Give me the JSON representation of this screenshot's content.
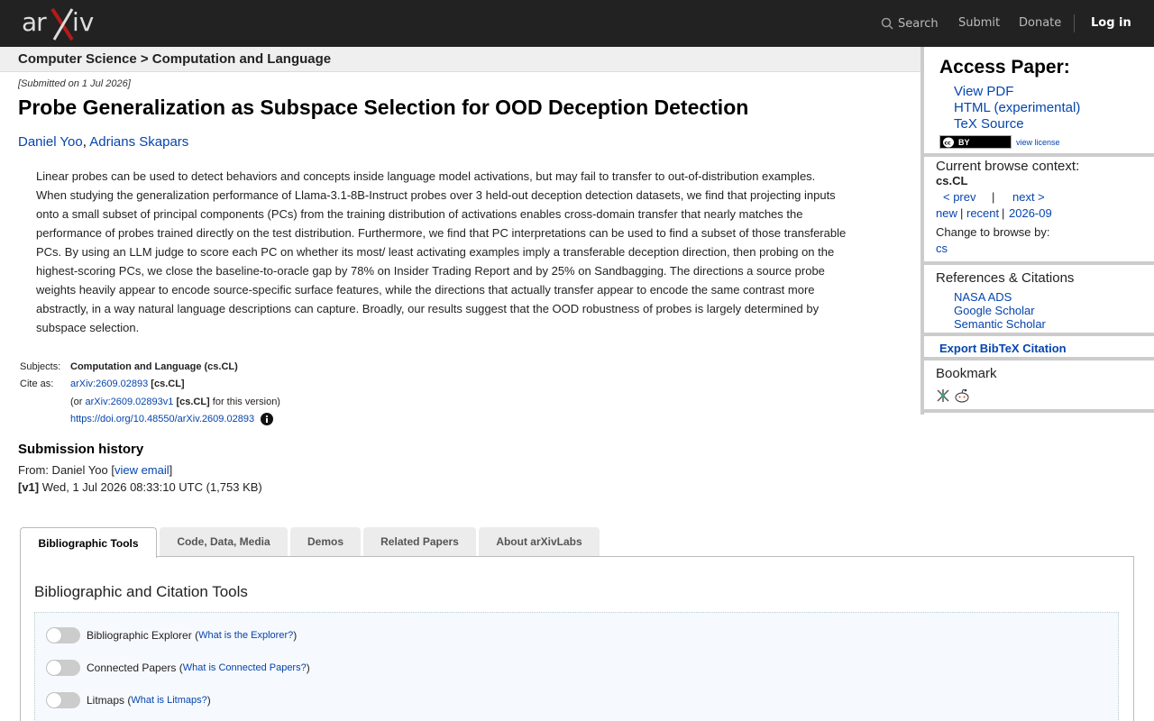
{
  "header": {
    "logo_text": "arXiv",
    "search_label": "Search",
    "submit_label": "Submit",
    "donate_label": "Donate",
    "login_label": "Log in"
  },
  "breadcrumb": "Computer Science > Computation and Language",
  "paper": {
    "submitted": "[Submitted on 1 Jul 2026]",
    "title": "Probe Generalization as Subspace Selection for OOD Deception Detection",
    "authors": [
      "Daniel Yoo",
      "Adrians Skapars"
    ],
    "abstract_lines": [
      "Linear probes can be used to detect behaviors and concepts inside language model activations, but may fail to transfer to out-of-distribution examples.",
      "When studying the generalization performance of Llama-3.1-8B-Instruct probes over 3 held-out deception detection datasets, we find that projecting inputs",
      "onto a small subset of principal components (PCs) from the training distribution of activations enables cross-domain transfer that nearly matches the",
      "performance of probes trained directly on the test distribution. Furthermore, we find that PC interpretations can be used to find a subset of those transferable",
      "PCs. By using an LLM judge to score each PC on whether its most/ least activating examples imply a transferable deception direction, then probing on the",
      "highest-scoring PCs, we close the baseline-to-oracle gap by 78% on Insider Trading Report and by 25% on Sandbagging. The directions a source probe",
      "weights heavily appear to encode source-specific surface features, while the directions that actually transfer appear to encode the same contrast more",
      "abstractly, in a way natural language descriptions can capture. Broadly, our results suggest that the OOD robustness of probes is largely determined by",
      "subspace selection."
    ]
  },
  "meta": {
    "subjects_label": "Subjects:",
    "subjects_value": "Computation and Language (cs.CL)",
    "cite_label": "Cite as:",
    "cite_id": "arXiv:2609.02893",
    "cite_tag": "[cs.CL]",
    "cite_or": "(or",
    "cite_version_id": "arXiv:2609.02893v1",
    "cite_version_tag": "[cs.CL]",
    "cite_version_suffix": "for this version)",
    "doi": "https://doi.org/10.48550/arXiv.2609.02893"
  },
  "history": {
    "title": "Submission history",
    "from_prefix": "From: Daniel Yoo [",
    "view_email": "view email",
    "from_suffix": "]",
    "v1_label": "[v1]",
    "v1_text": "Wed, 1 Jul 2026 08:33:10 UTC (1,753 KB)"
  },
  "tabs": [
    {
      "label": "Bibliographic Tools"
    },
    {
      "label": "Code, Data, Media"
    },
    {
      "label": "Demos"
    },
    {
      "label": "Related Papers"
    },
    {
      "label": "About arXivLabs"
    }
  ],
  "panel": {
    "title": "Bibliographic and Citation Tools",
    "tools": [
      {
        "name": "Bibliographic Explorer",
        "link": "What is the Explorer?"
      },
      {
        "name": "Connected Papers",
        "link": "What is Connected Papers?"
      },
      {
        "name": "Litmaps",
        "link": "What is Litmaps?"
      }
    ]
  },
  "sidebar": {
    "access_title": "Access Paper:",
    "view_pdf": "View PDF",
    "html": "HTML (experimental)",
    "tex": "TeX Source",
    "cc_label": "BY",
    "view_license": "view license",
    "browse_title": "Current browse context:",
    "browse_context": "cs.CL",
    "prev": "< prev",
    "sep": "|",
    "next": "next >",
    "new": "new",
    "recent": "recent",
    "month": "2026-09",
    "change_browse": "Change to browse by:",
    "cs": "cs",
    "refs_title": "References & Citations",
    "nasa": "NASA ADS",
    "google": "Google Scholar",
    "semantic": "Semantic Scholar",
    "export": "Export BibTeX Citation",
    "bookmark": "Bookmark"
  },
  "colors": {
    "header_bg": "#222222",
    "link": "#0645ad",
    "accent_red": "#b31b1b"
  }
}
